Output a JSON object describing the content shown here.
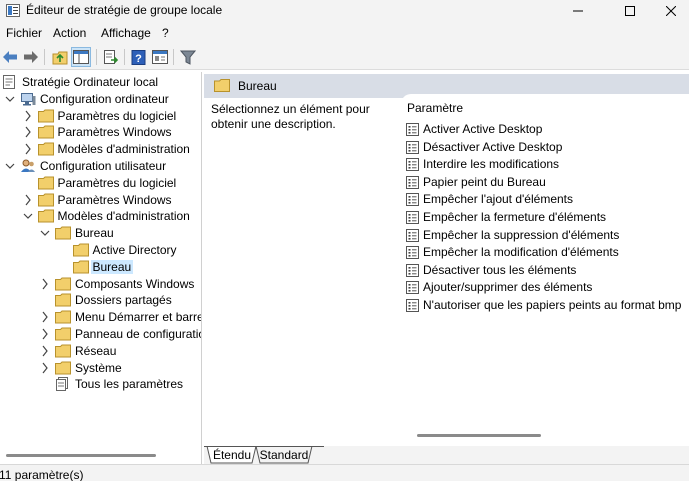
{
  "window": {
    "title": "Éditeur de stratégie de groupe locale"
  },
  "menu": {
    "items": [
      "Fichier",
      "Action",
      "Affichage",
      "?"
    ]
  },
  "toolbar": {
    "buttons": [
      "back-icon",
      "forward-icon",
      "up-folder-icon",
      "show-hide-tree-icon",
      "export-list-icon",
      "help-icon",
      "properties-icon",
      "filter-icon"
    ]
  },
  "tree": {
    "items": [
      {
        "label": "Stratégie Ordinateur local",
        "icon": "policy-icon"
      },
      {
        "label": "Configuration ordinateur",
        "icon": "computer-icon"
      },
      {
        "label": "Paramètres du logiciel",
        "icon": "folder-icon"
      },
      {
        "label": "Paramètres Windows",
        "icon": "folder-icon"
      },
      {
        "label": "Modèles d'administration",
        "icon": "folder-icon"
      },
      {
        "label": "Configuration utilisateur",
        "icon": "user-icon"
      },
      {
        "label": "Paramètres du logiciel",
        "icon": "folder-icon"
      },
      {
        "label": "Paramètres Windows",
        "icon": "folder-icon"
      },
      {
        "label": "Modèles d'administration",
        "icon": "folder-icon"
      },
      {
        "label": "Bureau",
        "icon": "folder-icon"
      },
      {
        "label": "Active Directory",
        "icon": "folder-icon"
      },
      {
        "label": "Bureau",
        "icon": "folder-icon",
        "selected": true
      },
      {
        "label": "Composants Windows",
        "icon": "folder-icon"
      },
      {
        "label": "Dossiers partagés",
        "icon": "folder-icon"
      },
      {
        "label": "Menu Démarrer et barre d",
        "icon": "folder-icon"
      },
      {
        "label": "Panneau de configuration",
        "icon": "folder-icon"
      },
      {
        "label": "Réseau",
        "icon": "folder-icon"
      },
      {
        "label": "Système",
        "icon": "folder-icon"
      },
      {
        "label": "Tous les paramètres",
        "icon": "all-settings-icon"
      }
    ]
  },
  "content": {
    "header": "Bureau",
    "description": "Sélectionnez un élément pour obtenir une description.",
    "column_header": "Paramètre",
    "settings": [
      "Activer Active Desktop",
      "Désactiver Active Desktop",
      "Interdire les modifications",
      "Papier peint du Bureau",
      "Empêcher l'ajout d'éléments",
      "Empêcher la fermeture d'éléments",
      "Empêcher la suppression d'éléments",
      "Empêcher la modification d'éléments",
      "Désactiver tous les éléments",
      "Ajouter/supprimer des éléments",
      "N'autoriser que les papiers peints au format bmp"
    ]
  },
  "tabs": [
    "Étendu",
    "Standard"
  ],
  "status": {
    "text": "11 paramètre(s)"
  },
  "colors": {
    "folder": "#f2cf6b",
    "selection": "#cce8ff",
    "header_band": "#d8dde6",
    "accent": "#2f6fb5"
  }
}
